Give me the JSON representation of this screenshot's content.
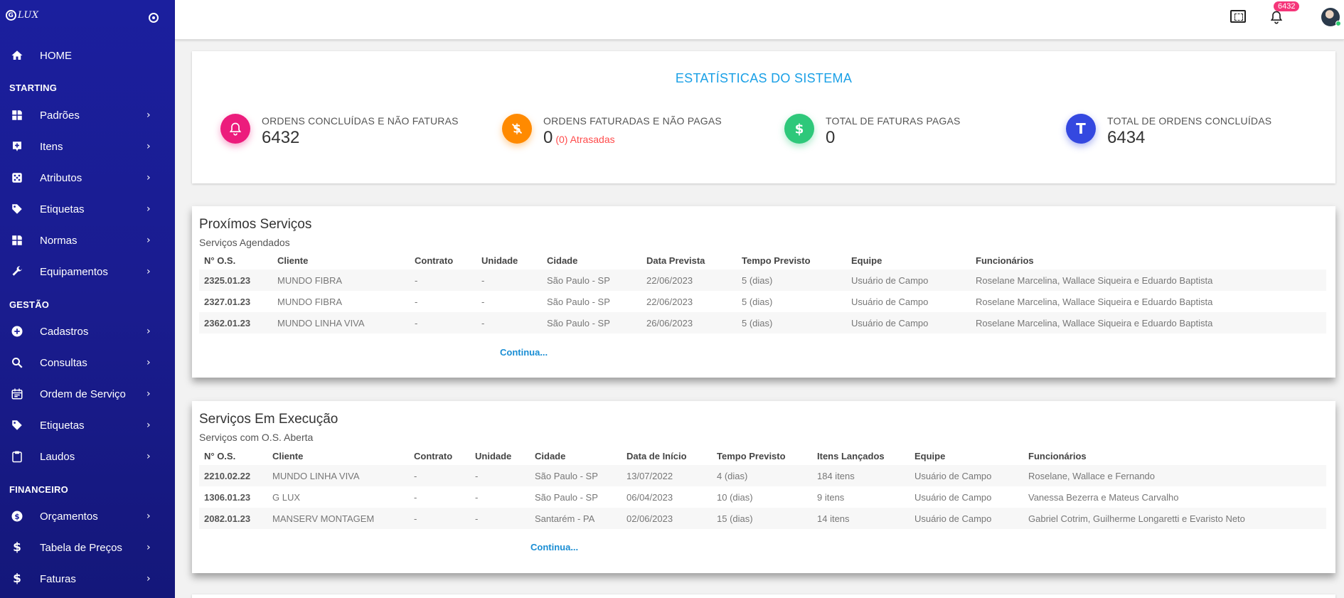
{
  "brand": {
    "logo_letter": "G",
    "logo_text": "LUX"
  },
  "sidebar": {
    "home": "HOME",
    "sections": {
      "starting": "STARTING",
      "gestao": "GESTÃO",
      "financeiro": "FINANCEIRO"
    },
    "starting_items": [
      {
        "label": "Padrões",
        "icon": "widgets-icon"
      },
      {
        "label": "Itens",
        "icon": "plus-box-icon"
      },
      {
        "label": "Atributos",
        "icon": "dice-icon"
      },
      {
        "label": "Etiquetas",
        "icon": "tag-icon"
      },
      {
        "label": "Normas",
        "icon": "widgets-icon"
      },
      {
        "label": "Equipamentos",
        "icon": "wrench-icon"
      }
    ],
    "gestao_items": [
      {
        "label": "Cadastros",
        "icon": "plus-circle-icon"
      },
      {
        "label": "Consultas",
        "icon": "search-icon"
      },
      {
        "label": "Ordem de Serviço",
        "icon": "calendar-icon"
      },
      {
        "label": "Etiquetas",
        "icon": "tag-icon"
      },
      {
        "label": "Laudos",
        "icon": "clipboard-icon"
      }
    ],
    "financeiro_items": [
      {
        "label": "Orçamentos",
        "icon": "dollar-circle-icon"
      },
      {
        "label": "Tabela de Preços",
        "icon": "dollar-icon"
      },
      {
        "label": "Faturas",
        "icon": "dollar-icon"
      }
    ]
  },
  "topbar": {
    "notifications_count": "6432"
  },
  "stats": {
    "title": "ESTATÍSTICAS DO SISTEMA",
    "items": [
      {
        "label": "ORDENS CONCLUÍDAS E NÃO FATURAS",
        "value": "6432",
        "color": "#ec1c7c",
        "icon": "bell-icon"
      },
      {
        "label": "ORDENS FATURADAS E NÃO PAGAS",
        "value": "0",
        "sub": "(0) Atrasadas",
        "color": "#ff8a00",
        "icon": "no-dollar-icon"
      },
      {
        "label": "TOTAL DE FATURAS PAGAS",
        "value": "0",
        "color": "#2ec87a",
        "icon": "dollar-icon"
      },
      {
        "label": "TOTAL DE ORDENS CONCLUÍDAS",
        "value": "6434",
        "color": "#3448e0",
        "icon_letter": "T"
      }
    ]
  },
  "proximos": {
    "title": "Proxímos Serviços",
    "subtitle": "Serviços Agendados",
    "headers": [
      "N° O.S.",
      "Cliente",
      "Contrato",
      "Unidade",
      "Cidade",
      "Data Prevista",
      "Tempo Previsto",
      "Equipe",
      "Funcionários"
    ],
    "rows": [
      [
        "2325.01.23",
        "MUNDO FIBRA",
        "-",
        "-",
        "São Paulo - SP",
        "22/06/2023",
        "5 (dias)",
        "Usuário de Campo",
        "Roselane Marcelina, Wallace Siqueira e Eduardo Baptista"
      ],
      [
        "2327.01.23",
        "MUNDO FIBRA",
        "-",
        "-",
        "São Paulo - SP",
        "22/06/2023",
        "5 (dias)",
        "Usuário de Campo",
        "Roselane Marcelina, Wallace Siqueira e Eduardo Baptista"
      ],
      [
        "2362.01.23",
        "MUNDO LINHA VIVA",
        "-",
        "-",
        "São Paulo - SP",
        "26/06/2023",
        "5 (dias)",
        "Usuário de Campo",
        "Roselane Marcelina, Wallace Siqueira e Eduardo Baptista"
      ]
    ],
    "more": "Continua..."
  },
  "execucao": {
    "title": "Serviços Em Execução",
    "subtitle": "Serviços com O.S. Aberta",
    "headers": [
      "N° O.S.",
      "Cliente",
      "Contrato",
      "Unidade",
      "Cidade",
      "Data de Início",
      "Tempo Previsto",
      "Itens Lançados",
      "Equipe",
      "Funcionários"
    ],
    "rows": [
      [
        "2210.02.22",
        "MUNDO LINHA VIVA",
        "-",
        "-",
        "São Paulo - SP",
        "13/07/2022",
        "4 (dias)",
        "184 itens",
        "Usuário de Campo",
        "Roselane, Wallace e Fernando"
      ],
      [
        "1306.01.23",
        "G LUX",
        "-",
        "-",
        "São Paulo - SP",
        "06/04/2023",
        "10 (dias)",
        "9 itens",
        "Usuário de Campo",
        "Vanessa Bezerra e Mateus Carvalho"
      ],
      [
        "2082.01.23",
        "MANSERV MONTAGEM",
        "-",
        "-",
        "Santarém - PA",
        "02/06/2023",
        "15 (dias)",
        "14 itens",
        "Usuário de Campo",
        "Gabriel Cotrim, Guilherme Longaretti e Evaristo Neto"
      ]
    ],
    "more": "Continua..."
  }
}
